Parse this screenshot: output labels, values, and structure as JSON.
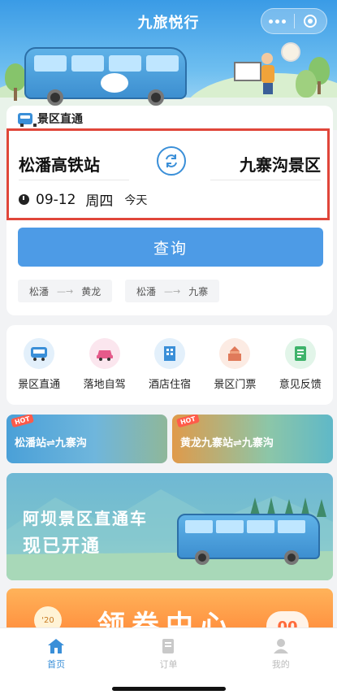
{
  "app": {
    "title": "九旅悦行"
  },
  "booking": {
    "tab_label": "景区直通",
    "from_station": "松潘高铁站",
    "to_station": "九寨沟景区",
    "date": "09-12",
    "weekday": "周四",
    "today": "今天",
    "query_label": "查询",
    "history": [
      {
        "from": "松潘",
        "to": "黄龙"
      },
      {
        "from": "松潘",
        "to": "九寨"
      }
    ]
  },
  "services": [
    {
      "label": "景区直通",
      "icon": "bus-icon",
      "color": "#3a8fd8"
    },
    {
      "label": "落地自驾",
      "icon": "car-icon",
      "color": "#e55a8a"
    },
    {
      "label": "酒店住宿",
      "icon": "hotel-icon",
      "color": "#3a8fd8"
    },
    {
      "label": "景区门票",
      "icon": "ticket-icon",
      "color": "#e07a5a"
    },
    {
      "label": "意见反馈",
      "icon": "feedback-icon",
      "color": "#3fb36b"
    }
  ],
  "banners": {
    "left": {
      "tag": "HOT",
      "text": "松潘站⇌九寨沟"
    },
    "right": {
      "tag": "HOT",
      "text": "黄龙九寨站⇌九寨沟"
    },
    "big": {
      "line1": "阿坝景区直通车",
      "line2": "现已开通"
    },
    "coupon": {
      "text": "领券中心",
      "coin_text": "'20",
      "bubble_text": "00"
    }
  },
  "tabbar": [
    {
      "label": "首页",
      "icon": "home-icon",
      "active": true
    },
    {
      "label": "订单",
      "icon": "order-icon",
      "active": false
    },
    {
      "label": "我的",
      "icon": "profile-icon",
      "active": false
    }
  ],
  "colors": {
    "accent": "#4d9be6",
    "highlight_border": "#e0463a",
    "tab_active": "#3a8fd8",
    "tab_inactive": "#bbbbbb"
  }
}
